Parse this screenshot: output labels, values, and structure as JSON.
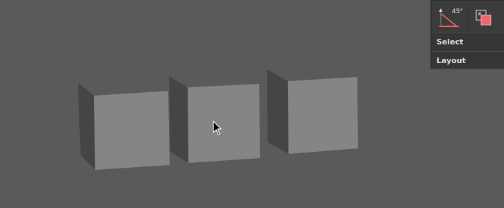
{
  "panel": {
    "angle_tool": {
      "icon": "angle-snap-icon",
      "label": "45°"
    },
    "color_tool": {
      "icon": "color-swatch-icon",
      "accent": "#f2656b"
    },
    "sections": {
      "select": "Select",
      "layout": "Layout"
    }
  },
  "colors": {
    "viewport_bg": "#5a5a5a",
    "cube_front": "#858585",
    "cube_side": "#454545",
    "panel_bg": "#3a3a3a",
    "panel_text": "#e0e0e0",
    "accent": "#f2656b"
  }
}
